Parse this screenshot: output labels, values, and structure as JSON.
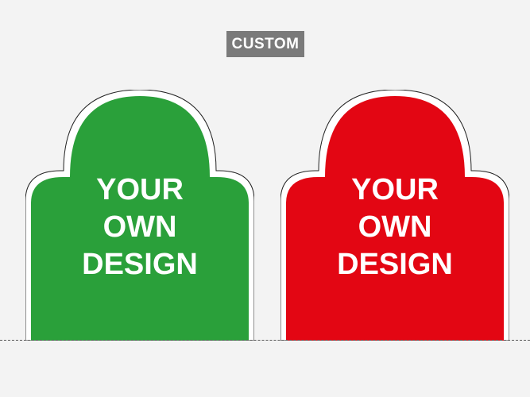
{
  "badge": {
    "label": "CUSTOM",
    "color": "#7a7a7a"
  },
  "signs": [
    {
      "color": "#2aa03a",
      "lines": [
        "YOUR",
        "OWN",
        "DESIGN"
      ]
    },
    {
      "color": "#e30613",
      "lines": [
        "YOUR",
        "OWN",
        "DESIGN"
      ]
    }
  ]
}
